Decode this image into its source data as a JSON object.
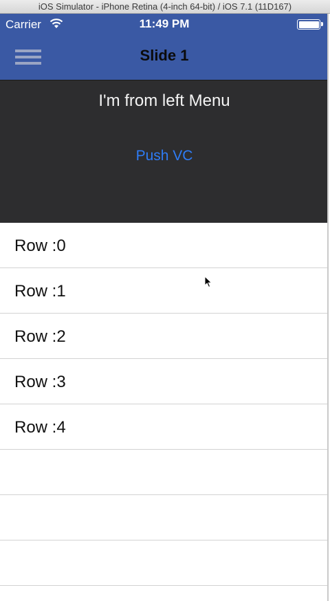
{
  "simulator": {
    "title": "iOS Simulator - iPhone Retina (4-inch 64-bit) / iOS 7.1 (11D167)"
  },
  "status_bar": {
    "carrier": "Carrier",
    "time": "11:49 PM",
    "wifi_icon": "wifi-icon",
    "battery_icon": "battery-icon"
  },
  "nav_bar": {
    "title": "Slide 1",
    "menu_icon": "hamburger-menu-icon",
    "background_color": "#3a59a4"
  },
  "header": {
    "label": "I'm from left Menu",
    "button_label": "Push VC",
    "background_color": "#2d2d2f",
    "button_color": "#2e7cf6"
  },
  "table": {
    "rows": [
      {
        "label": "Row :0"
      },
      {
        "label": "Row :1"
      },
      {
        "label": "Row :2"
      },
      {
        "label": "Row :3"
      },
      {
        "label": "Row :4"
      },
      {
        "label": ""
      },
      {
        "label": ""
      },
      {
        "label": ""
      }
    ]
  }
}
